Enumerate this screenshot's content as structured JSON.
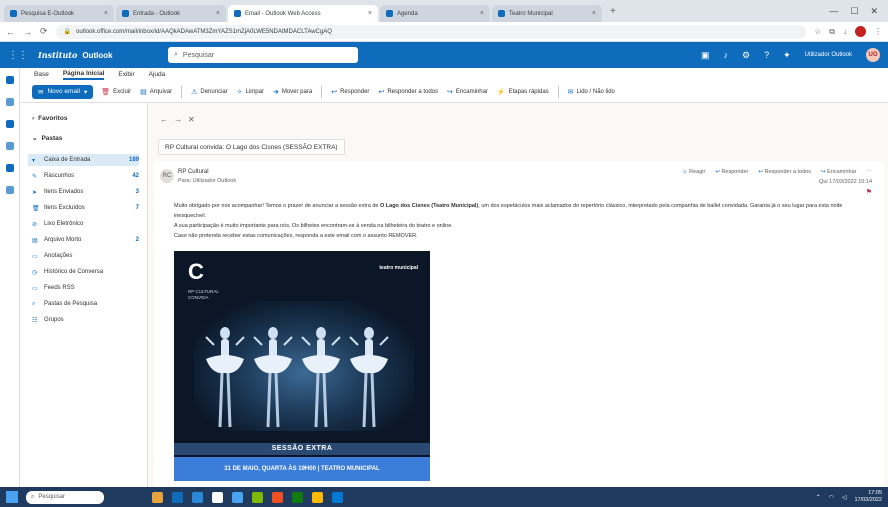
{
  "browser": {
    "tabs": [
      {
        "label": "Pesquisa E-Outlook",
        "active": false
      },
      {
        "label": "Entrada - Outlook",
        "active": false
      },
      {
        "label": "Email - Outlook Web Access",
        "active": true
      },
      {
        "label": "Agenda",
        "active": false
      },
      {
        "label": "Teatro Municipal",
        "active": false
      }
    ],
    "url": "outlook.office.com/mail/inbox/id/AAQkADAwATM3ZmYAZS1mZjA0LWE5NDAtMDACLTAwCgAQ",
    "window_controls": [
      "—",
      "☐",
      "✕"
    ]
  },
  "outlook": {
    "brand": "Outlook",
    "org_signature": "Instituto",
    "search_placeholder": "Pesquisar",
    "user_name": "Utilizador Outlook",
    "user_initials": "UO"
  },
  "ribbon": {
    "tabs": [
      "Base",
      "Página Inicial",
      "Exibir",
      "Ajuda"
    ],
    "selected_tab": "Página Inicial",
    "new_mail": "Novo email",
    "buttons": [
      {
        "icon": "trash",
        "label": "Excluir",
        "red": true
      },
      {
        "icon": "archive",
        "label": "Arquivar"
      },
      {
        "icon": "report",
        "label": "Denunciar"
      },
      {
        "icon": "sweep",
        "label": "Limpar"
      },
      {
        "icon": "move",
        "label": "Mover para"
      },
      {
        "icon": "reply",
        "label": "Responder"
      },
      {
        "icon": "reply-all",
        "label": "Responder a todos"
      },
      {
        "icon": "forward",
        "label": "Encaminhar"
      },
      {
        "icon": "quick",
        "label": "Etapas rápidas"
      },
      {
        "icon": "read",
        "label": "Lido / Não lido"
      }
    ]
  },
  "folders": {
    "favorites_label": "Favoritos",
    "folders_label": "Pastas",
    "items": [
      {
        "icon": "inbox",
        "label": "Caixa de Entrada",
        "count": "189",
        "active": true
      },
      {
        "icon": "pencil",
        "label": "Rascunhos",
        "count": "42"
      },
      {
        "icon": "sent",
        "label": "Itens Enviados",
        "count": "3"
      },
      {
        "icon": "trash",
        "label": "Itens Excluídos",
        "count": "7"
      },
      {
        "icon": "junk",
        "label": "Lixo Eletrônico",
        "count": ""
      },
      {
        "icon": "archive",
        "label": "Arquivo Morto",
        "count": "2"
      },
      {
        "icon": "folder",
        "label": "Anotações",
        "count": ""
      },
      {
        "icon": "history",
        "label": "Histórico de Conversa",
        "count": ""
      },
      {
        "icon": "folder",
        "label": "Feeds RSS",
        "count": ""
      },
      {
        "icon": "search",
        "label": "Pastas de Pesquisa",
        "count": ""
      },
      {
        "icon": "group",
        "label": "Grupos",
        "count": ""
      }
    ]
  },
  "message": {
    "subject": "RP Cultural convida: O Lago dos Cisnes (SESSÃO EXTRA)",
    "sender_initials": "RC",
    "sender": "RP Cultural",
    "to": "Para: Utilizador Outlook",
    "actions": [
      "Reagir",
      "Responder",
      "Responder a todos",
      "Encaminhar"
    ],
    "date": "Qui 17/03/2022 10:14",
    "body_intro": "Muito obrigado por nos acompanhar! Temos o prazer de anunciar a sessão extra de",
    "body_highlight": "O Lago dos Cisnes (Teatro Municipal)",
    "body_rest": ", um dos espetáculos mais aclamados do repertório clássico, interpretado pela companhia de ballet convidada. Garanta já o seu lugar para esta noite inesquecível.",
    "body_line2": "A sua participação é muito importante para nós. Os bilhetes encontram-se à venda na bilheteira do teatro e online.",
    "body_line3": "Caso não pretenda receber estas comunicações, responda a este email com o assunto REMOVER.",
    "poster": {
      "logo_text": "RP CULTURAL\nCONVIDA",
      "right_logo": "teatro municipal",
      "title": "SESSÃO EXTRA",
      "date_line": "31 DE MAIO, QUARTA ÀS 19H00 | TEATRO MUNICIPAL"
    }
  },
  "taskbar": {
    "search_placeholder": "Pesquisar",
    "apps": [
      "#e8a33d",
      "#0f6cbd",
      "#2b88d8",
      "#ffffff",
      "#4aa3f0",
      "#7fba00",
      "#f25022",
      "#107c10",
      "#ffb900",
      "#0078d4"
    ],
    "time": "17:05",
    "date": "17/03/2022"
  }
}
